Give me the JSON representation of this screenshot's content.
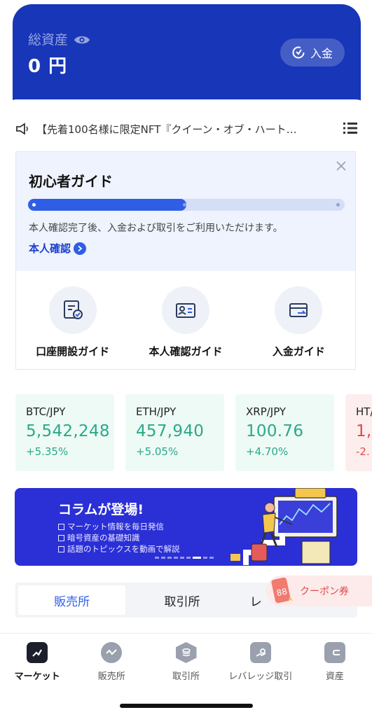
{
  "colors": {
    "primary": "#1736b8",
    "accent": "#2f5ee6",
    "positive": "#2aa98a",
    "negative": "#e04a4a"
  },
  "header": {
    "asset_label": "総資産",
    "asset_value": "0 円",
    "deposit_label": "入金"
  },
  "notice": {
    "text": "【先着100名様に限定NFT『クイーン・オブ・ハート…"
  },
  "guide": {
    "title": "初心者ガイド",
    "progress_percent": 50,
    "description": "本人確認完了後、入金および取引をご利用いただけます。",
    "link_label": "本人確認",
    "items": [
      {
        "label": "口座開設ガイド",
        "icon": "account-opening-icon"
      },
      {
        "label": "本人確認ガイド",
        "icon": "id-card-icon"
      },
      {
        "label": "入金ガイド",
        "icon": "wallet-icon"
      }
    ]
  },
  "tickers": [
    {
      "pair": "BTC/JPY",
      "price": "5,542,248",
      "change": "+5.35%",
      "trend": "up"
    },
    {
      "pair": "ETH/JPY",
      "price": "457,940",
      "change": "+5.05%",
      "trend": "up"
    },
    {
      "pair": "XRP/JPY",
      "price": "100.76",
      "change": "+4.70%",
      "trend": "up"
    },
    {
      "pair": "HT/",
      "price": "1,",
      "change": "-2.",
      "trend": "down"
    }
  ],
  "banner": {
    "title": "コラムが登場!",
    "items": [
      "マーケット情報を毎日発信",
      "暗号資産の基礎知識",
      "話題のトピックスを動画で解説"
    ]
  },
  "segment": {
    "tabs": [
      "販売所",
      "取引所",
      "レ"
    ],
    "active_index": 0
  },
  "coupon": {
    "label": "クーポン券",
    "badge": "88"
  },
  "bottom_nav": {
    "items": [
      {
        "label": "マーケット",
        "icon": "market-icon",
        "active": true
      },
      {
        "label": "販売所",
        "icon": "exchange-shop-icon",
        "active": false
      },
      {
        "label": "取引所",
        "icon": "trade-icon",
        "active": false
      },
      {
        "label": "レバレッジ取引",
        "icon": "leverage-icon",
        "active": false
      },
      {
        "label": "資産",
        "icon": "wallet-icon",
        "active": false
      }
    ]
  }
}
